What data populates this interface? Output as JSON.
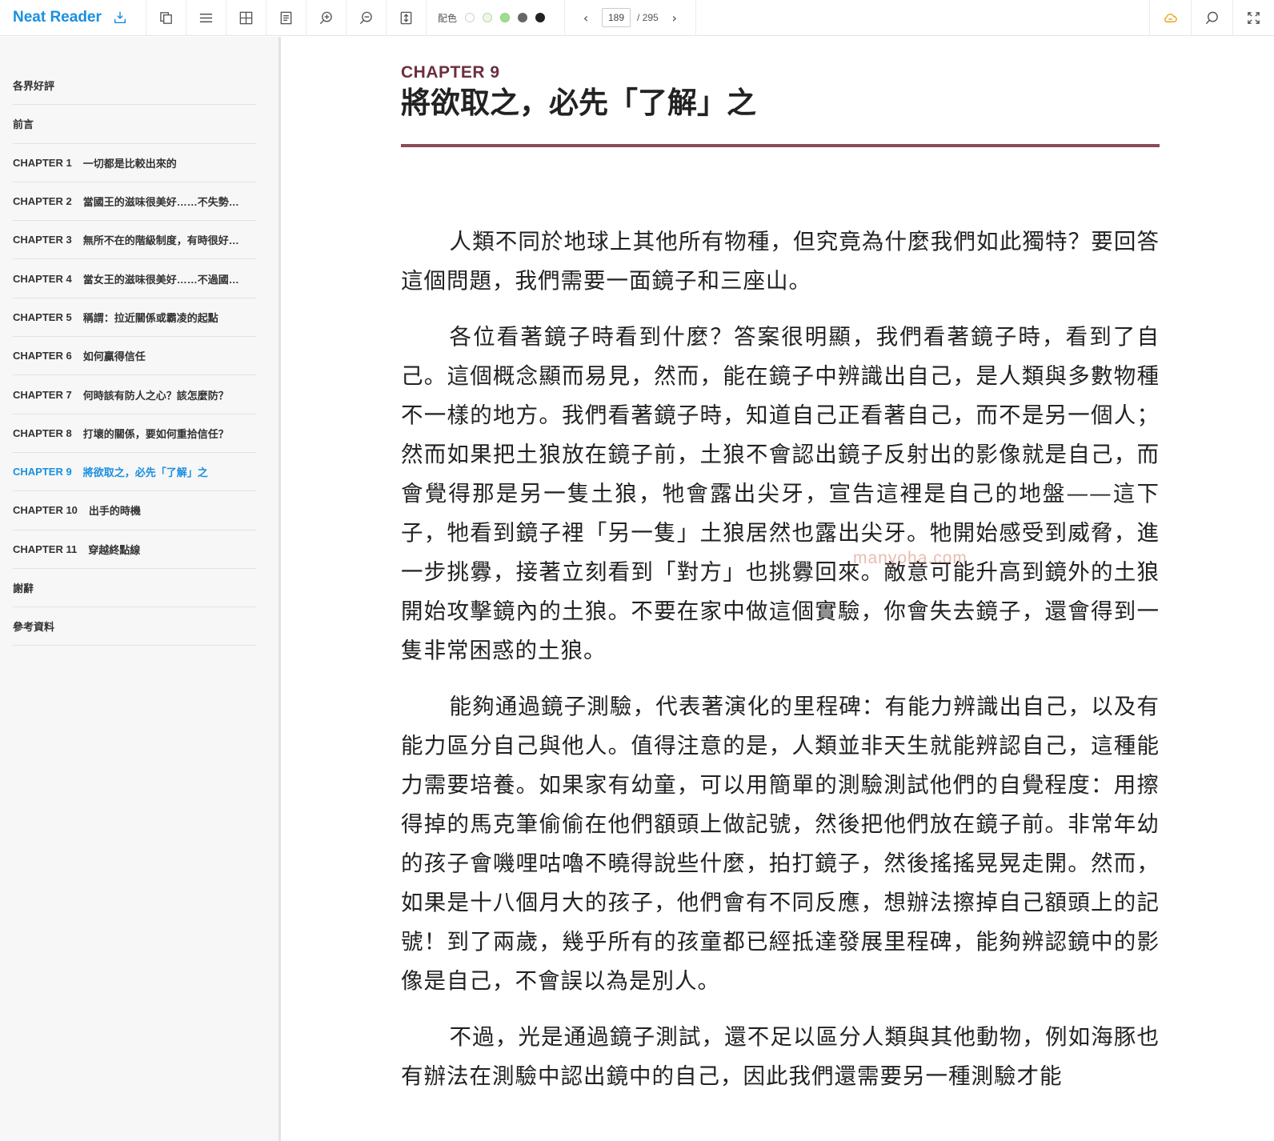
{
  "app": {
    "name": "Neat Reader"
  },
  "toolbar": {
    "palette_label": "配色",
    "swatches": [
      "#ffffff",
      "#eef6e9",
      "#9fde8f",
      "#666666",
      "#222222"
    ],
    "page_current": "189",
    "page_total": "/ 295"
  },
  "toc": [
    {
      "chapter": "",
      "title": "各界好評"
    },
    {
      "chapter": "",
      "title": "前言"
    },
    {
      "chapter": "CHAPTER 1",
      "title": "一切都是比較出來的"
    },
    {
      "chapter": "CHAPTER 2",
      "title": "當國王的滋味很美好……不失勢…"
    },
    {
      "chapter": "CHAPTER 3",
      "title": "無所不在的階級制度，有時很好…"
    },
    {
      "chapter": "CHAPTER 4",
      "title": "當女王的滋味很美好……不過國…"
    },
    {
      "chapter": "CHAPTER 5",
      "title": "稱謂：拉近關係或霸凌的起點"
    },
    {
      "chapter": "CHAPTER 6",
      "title": "如何贏得信任"
    },
    {
      "chapter": "CHAPTER 7",
      "title": "何時該有防人之心？該怎麼防？"
    },
    {
      "chapter": "CHAPTER 8",
      "title": "打壞的關係，要如何重拾信任？"
    },
    {
      "chapter": "CHAPTER 9",
      "title": "將欲取之，必先「了解」之",
      "active": true
    },
    {
      "chapter": "CHAPTER 10",
      "title": "出手的時機"
    },
    {
      "chapter": "CHAPTER 11",
      "title": "穿越終點線"
    },
    {
      "chapter": "",
      "title": "謝辭"
    },
    {
      "chapter": "",
      "title": "參考資料"
    }
  ],
  "article": {
    "chapter_label": "CHAPTER 9",
    "title": "將欲取之，必先「了解」之",
    "accent_color": "#8c4b57",
    "paragraphs": [
      "人類不同於地球上其他所有物種，但究竟為什麼我們如此獨特？要回答這個問題，我們需要一面鏡子和三座山。",
      "各位看著鏡子時看到什麼？答案很明顯，我們看著鏡子時，看到了自己。這個概念顯而易見，然而，能在鏡子中辨識出自己，是人類與多數物種不一樣的地方。我們看著鏡子時，知道自己正看著自己，而不是另一個人；然而如果把土狼放在鏡子前，土狼不會認出鏡子反射出的影像就是自己，而會覺得那是另一隻土狼，牠會露出尖牙，宣告這裡是自己的地盤——這下子，牠看到鏡子裡「另一隻」土狼居然也露出尖牙。牠開始感受到威脅，進一步挑釁，接著立刻看到「對方」也挑釁回來。敵意可能升高到鏡外的土狼開始攻擊鏡內的土狼。不要在家中做這個實驗，你會失去鏡子，還會得到一隻非常困惑的土狼。",
      "能夠通過鏡子測驗，代表著演化的里程碑：有能力辨識出自己，以及有能力區分自己與他人。值得注意的是，人類並非天生就能辨認自己，這種能力需要培養。如果家有幼童，可以用簡單的測驗測試他們的自覺程度：用擦得掉的馬克筆偷偷在他們額頭上做記號，然後把他們放在鏡子前。非常年幼的孩子會嘰哩咕嚕不曉得說些什麼，拍打鏡子，然後搖搖晃晃走開。然而，如果是十八個月大的孩子，他們會有不同反應，想辦法擦掉自己額頭上的記號！到了兩歲，幾乎所有的孩童都已經抵達發展里程碑，能夠辨認鏡中的影像是自己，不會誤以為是別人。",
      "不過，光是通過鏡子測試，還不足以區分人類與其他動物，例如海豚也有辦法在測驗中認出鏡中的自己，因此我們還需要另一種測驗才能"
    ],
    "watermark": "manyoha.com"
  }
}
